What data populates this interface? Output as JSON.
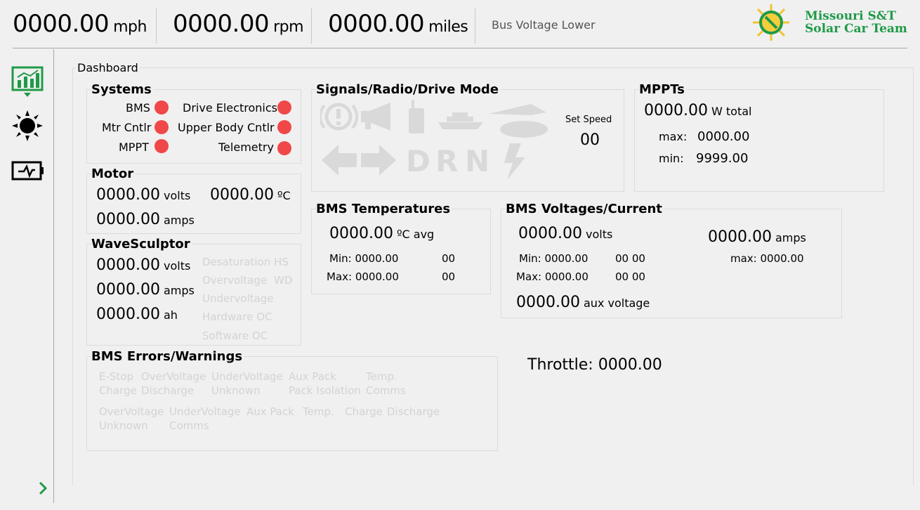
{
  "topbar": {
    "speed_value": "0000.00",
    "speed_unit": "mph",
    "rpm_value": "0000.00",
    "rpm_unit": "rpm",
    "miles_value": "0000.00",
    "miles_unit": "miles",
    "status": "Bus Voltage Lower"
  },
  "logo": {
    "line1": "Missouri S&T",
    "line2": "Solar Car Team"
  },
  "sidebar": {
    "items": [
      "dashboard",
      "solar",
      "battery"
    ],
    "expand_icon": "chevron-right-icon"
  },
  "dashboard": {
    "title": "Dashboard"
  },
  "systems": {
    "title": "Systems",
    "items": [
      "BMS",
      "Drive Electronics",
      "Mtr Cntlr",
      "Upper Body Cntlr",
      "MPPT",
      "Telemetry"
    ],
    "status_color": "#f04848"
  },
  "motor": {
    "title": "Motor",
    "volts": "0000.00",
    "volts_unit": "volts",
    "temp": "0000.00",
    "temp_unit": "ºC",
    "amps": "0000.00",
    "amps_unit": "amps"
  },
  "wavesculptor": {
    "title": "WaveSculptor",
    "volts": "0000.00",
    "volts_unit": "volts",
    "amps": "0000.00",
    "amps_unit": "amps",
    "ah": "0000.00",
    "ah_unit": "ah",
    "flags": [
      "Desaturation",
      "HS",
      "Overvoltage",
      "WD",
      "Undervoltage",
      "Hardware OC",
      "Software OC"
    ]
  },
  "signals": {
    "title": "Signals/Radio/Drive Mode",
    "set_speed_label": "Set Speed",
    "set_speed_value": "00",
    "drive_letters": [
      "D",
      "R",
      "N"
    ]
  },
  "mppts": {
    "title": "MPPTs",
    "total": "0000.00",
    "total_unit": "W total",
    "max_label": "max:",
    "max_value": "0000.00",
    "min_label": "min:",
    "min_value": "9999.00"
  },
  "bms_temps": {
    "title": "BMS Temperatures",
    "avg": "0000.00",
    "avg_unit": "ºC avg",
    "min_label": "Min: 0000.00",
    "min_id": "00",
    "max_label": "Max: 0000.00",
    "max_id": "00"
  },
  "bms_vc": {
    "title": "BMS Voltages/Current",
    "volts": "0000.00",
    "volts_unit": "volts",
    "amps": "0000.00",
    "amps_unit": "amps",
    "min_label": "Min: 0000.00",
    "min_id": "00  00",
    "max_label": "Max: 0000.00",
    "max_id": "00  00",
    "amps_max": "max:  0000.00",
    "aux": "0000.00",
    "aux_unit": "aux voltage"
  },
  "bms_errors": {
    "title": "BMS Errors/Warnings",
    "row1": [
      "E-Stop",
      "OverVoltage",
      "UnderVoltage",
      "Aux Pack",
      "Temp."
    ],
    "row2": [
      "Charge",
      "Discharge",
      "Unknown",
      "Pack Isolation",
      "Comms"
    ],
    "row3": [
      "OverVoltage",
      "UnderVoltage",
      "Aux Pack",
      "Temp.",
      "Charge",
      "Discharge"
    ],
    "row4": [
      "Unknown",
      "Comms"
    ]
  },
  "throttle": {
    "label": "Throttle:",
    "value": "0000.00"
  }
}
